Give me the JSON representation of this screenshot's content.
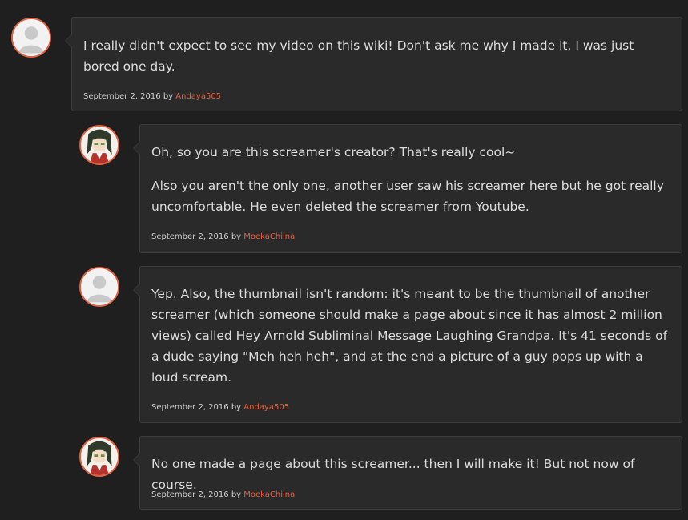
{
  "comments": [
    {
      "author": "Andaya505",
      "avatar_icon": "default-user-icon",
      "paragraphs": [
        "I really didn't expect to see my video on this wiki! Don't ask me why I made it, I was just bored one day."
      ],
      "date": "September 2, 2016",
      "by": "by"
    },
    {
      "author": "MoekaChiina",
      "avatar_icon": "anime-character-avatar-icon",
      "paragraphs": [
        "Oh, so you are this screamer's creator? That's really cool~",
        "Also you aren't the only one, another user saw his screamer here but he got really uncomfortable. He even deleted the screamer from Youtube."
      ],
      "date": "September 2, 2016",
      "by": "by"
    },
    {
      "author": "Andaya505",
      "avatar_icon": "default-user-icon",
      "paragraphs": [
        "Yep. Also, the thumbnail isn't random: it's meant to be the thumbnail of another screamer (which someone should make a page about since it has almost 2 million views) called Hey Arnold Subliminal Message Laughing Grandpa. It's 41 seconds of a dude saying \"Meh heh heh\", and at the end a picture of a guy pops up with a loud scream."
      ],
      "date": "September 2, 2016",
      "by": "by"
    },
    {
      "author": "MoekaChiina",
      "avatar_icon": "anime-character-avatar-icon",
      "paragraphs": [
        "No one made a page about this screamer... then I will make it! But not now of course."
      ],
      "date": "September 2, 2016",
      "by": "by"
    }
  ],
  "colors": {
    "accent": "#e0603f",
    "background": "#1f1f1f",
    "bubble": "#2a2a2a"
  }
}
